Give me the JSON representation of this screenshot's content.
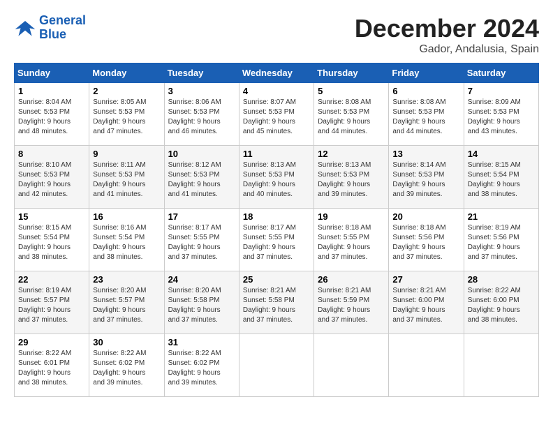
{
  "header": {
    "logo_line1": "General",
    "logo_line2": "Blue",
    "month": "December 2024",
    "location": "Gador, Andalusia, Spain"
  },
  "weekdays": [
    "Sunday",
    "Monday",
    "Tuesday",
    "Wednesday",
    "Thursday",
    "Friday",
    "Saturday"
  ],
  "weeks": [
    [
      {
        "day": 1,
        "sunrise": "8:04 AM",
        "sunset": "5:53 PM",
        "daylight": "9 hours and 48 minutes."
      },
      {
        "day": 2,
        "sunrise": "8:05 AM",
        "sunset": "5:53 PM",
        "daylight": "9 hours and 47 minutes."
      },
      {
        "day": 3,
        "sunrise": "8:06 AM",
        "sunset": "5:53 PM",
        "daylight": "9 hours and 46 minutes."
      },
      {
        "day": 4,
        "sunrise": "8:07 AM",
        "sunset": "5:53 PM",
        "daylight": "9 hours and 45 minutes."
      },
      {
        "day": 5,
        "sunrise": "8:08 AM",
        "sunset": "5:53 PM",
        "daylight": "9 hours and 44 minutes."
      },
      {
        "day": 6,
        "sunrise": "8:08 AM",
        "sunset": "5:53 PM",
        "daylight": "9 hours and 44 minutes."
      },
      {
        "day": 7,
        "sunrise": "8:09 AM",
        "sunset": "5:53 PM",
        "daylight": "9 hours and 43 minutes."
      }
    ],
    [
      {
        "day": 8,
        "sunrise": "8:10 AM",
        "sunset": "5:53 PM",
        "daylight": "9 hours and 42 minutes."
      },
      {
        "day": 9,
        "sunrise": "8:11 AM",
        "sunset": "5:53 PM",
        "daylight": "9 hours and 41 minutes."
      },
      {
        "day": 10,
        "sunrise": "8:12 AM",
        "sunset": "5:53 PM",
        "daylight": "9 hours and 41 minutes."
      },
      {
        "day": 11,
        "sunrise": "8:13 AM",
        "sunset": "5:53 PM",
        "daylight": "9 hours and 40 minutes."
      },
      {
        "day": 12,
        "sunrise": "8:13 AM",
        "sunset": "5:53 PM",
        "daylight": "9 hours and 39 minutes."
      },
      {
        "day": 13,
        "sunrise": "8:14 AM",
        "sunset": "5:53 PM",
        "daylight": "9 hours and 39 minutes."
      },
      {
        "day": 14,
        "sunrise": "8:15 AM",
        "sunset": "5:54 PM",
        "daylight": "9 hours and 38 minutes."
      }
    ],
    [
      {
        "day": 15,
        "sunrise": "8:15 AM",
        "sunset": "5:54 PM",
        "daylight": "9 hours and 38 minutes."
      },
      {
        "day": 16,
        "sunrise": "8:16 AM",
        "sunset": "5:54 PM",
        "daylight": "9 hours and 38 minutes."
      },
      {
        "day": 17,
        "sunrise": "8:17 AM",
        "sunset": "5:55 PM",
        "daylight": "9 hours and 37 minutes."
      },
      {
        "day": 18,
        "sunrise": "8:17 AM",
        "sunset": "5:55 PM",
        "daylight": "9 hours and 37 minutes."
      },
      {
        "day": 19,
        "sunrise": "8:18 AM",
        "sunset": "5:55 PM",
        "daylight": "9 hours and 37 minutes."
      },
      {
        "day": 20,
        "sunrise": "8:18 AM",
        "sunset": "5:56 PM",
        "daylight": "9 hours and 37 minutes."
      },
      {
        "day": 21,
        "sunrise": "8:19 AM",
        "sunset": "5:56 PM",
        "daylight": "9 hours and 37 minutes."
      }
    ],
    [
      {
        "day": 22,
        "sunrise": "8:19 AM",
        "sunset": "5:57 PM",
        "daylight": "9 hours and 37 minutes."
      },
      {
        "day": 23,
        "sunrise": "8:20 AM",
        "sunset": "5:57 PM",
        "daylight": "9 hours and 37 minutes."
      },
      {
        "day": 24,
        "sunrise": "8:20 AM",
        "sunset": "5:58 PM",
        "daylight": "9 hours and 37 minutes."
      },
      {
        "day": 25,
        "sunrise": "8:21 AM",
        "sunset": "5:58 PM",
        "daylight": "9 hours and 37 minutes."
      },
      {
        "day": 26,
        "sunrise": "8:21 AM",
        "sunset": "5:59 PM",
        "daylight": "9 hours and 37 minutes."
      },
      {
        "day": 27,
        "sunrise": "8:21 AM",
        "sunset": "6:00 PM",
        "daylight": "9 hours and 37 minutes."
      },
      {
        "day": 28,
        "sunrise": "8:22 AM",
        "sunset": "6:00 PM",
        "daylight": "9 hours and 38 minutes."
      }
    ],
    [
      {
        "day": 29,
        "sunrise": "8:22 AM",
        "sunset": "6:01 PM",
        "daylight": "9 hours and 38 minutes."
      },
      {
        "day": 30,
        "sunrise": "8:22 AM",
        "sunset": "6:02 PM",
        "daylight": "9 hours and 39 minutes."
      },
      {
        "day": 31,
        "sunrise": "8:22 AM",
        "sunset": "6:02 PM",
        "daylight": "9 hours and 39 minutes."
      },
      null,
      null,
      null,
      null
    ]
  ]
}
